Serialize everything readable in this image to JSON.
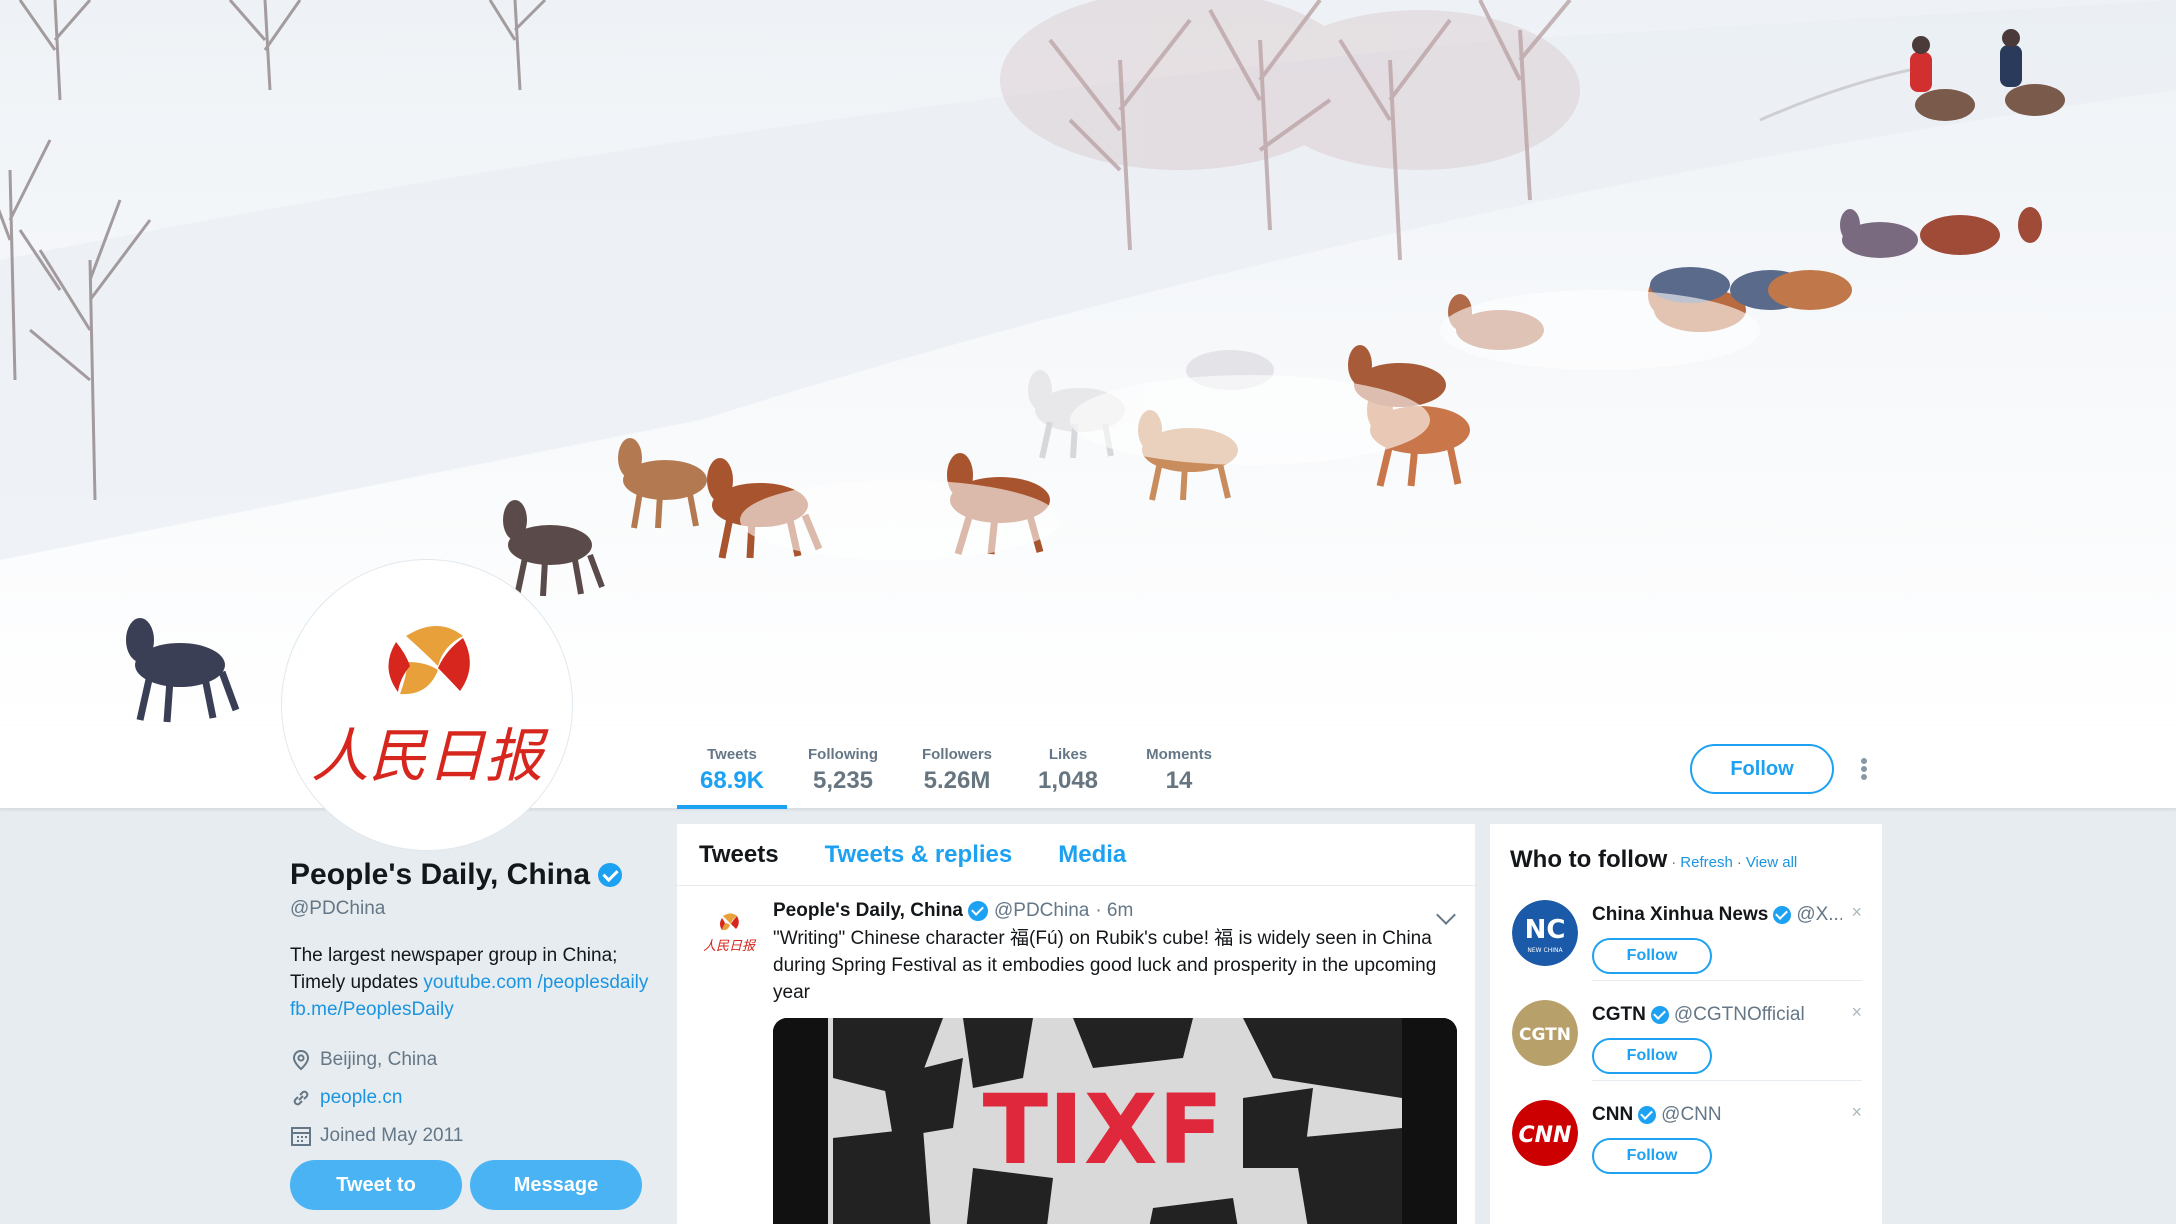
{
  "profile": {
    "name": "People's Daily, China",
    "handle": "@PDChina",
    "bio_text": "The largest newspaper group in China; Timely updates ",
    "bio_link1": "youtube.com /peoplesdaily",
    "bio_link2": "fb.me/PeoplesDaily",
    "location": "Beijing, China",
    "website": "people.cn",
    "joined": "Joined May 2011",
    "avatar_text": "人民日报"
  },
  "nav": {
    "stats": [
      {
        "label": "Tweets",
        "value": "68.9K"
      },
      {
        "label": "Following",
        "value": "5,235"
      },
      {
        "label": "Followers",
        "value": "5.26M"
      },
      {
        "label": "Likes",
        "value": "1,048"
      },
      {
        "label": "Moments",
        "value": "14"
      }
    ],
    "follow_label": "Follow"
  },
  "actions": {
    "tweet_to": "Tweet to",
    "message": "Message"
  },
  "timeline": {
    "tabs": [
      "Tweets",
      "Tweets & replies",
      "Media"
    ],
    "tweet": {
      "name": "People's Daily, China",
      "handle": "@PDChina",
      "time": "· 6m",
      "text": "\"Writing\" Chinese character 福(Fú) on Rubik's cube! 福 is widely seen in China during Spring Festival as it embodies good luck and prosperity in the upcoming year",
      "media_text": "TIXF"
    }
  },
  "who_to_follow": {
    "title": "Who to follow",
    "refresh": "Refresh",
    "dot": "·",
    "view_all": "View all",
    "items": [
      {
        "name": "China Xinhua News",
        "handle": "@X...",
        "follow": "Follow",
        "close": "×",
        "avatar_text": "NEW CHINA"
      },
      {
        "name": "CGTN",
        "handle": "@CGTNOfficial",
        "follow": "Follow",
        "close": "×",
        "avatar_text": "CGTN"
      },
      {
        "name": "CNN",
        "handle": "@CNN",
        "follow": "Follow",
        "close": "×",
        "avatar_text": "CNN"
      }
    ]
  },
  "colors": {
    "accent": "#1da1f2",
    "link": "#1b95e0",
    "background": "#e6ecf0",
    "logo_red": "#d7261e",
    "logo_orange": "#e8a13a"
  },
  "icons": [
    "location-icon",
    "link-icon",
    "calendar-icon",
    "verified-icon",
    "caret-down-icon",
    "more-dots-icon",
    "close-icon"
  ]
}
